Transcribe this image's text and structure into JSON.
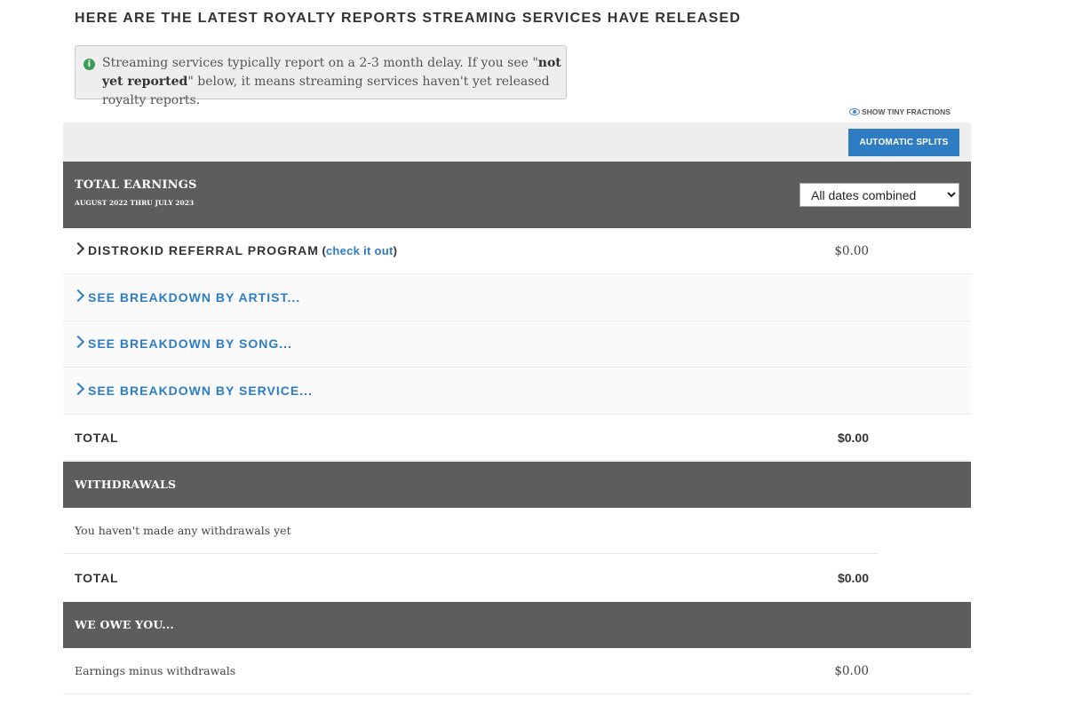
{
  "headline": "HERE ARE THE LATEST ROYALTY REPORTS STREAMING SERVICES HAVE RELEASED",
  "notice": {
    "icon": "info-icon",
    "text_before": "Streaming services typically report on a 2-3 month delay. If you see \"",
    "text_bold": "not yet reported",
    "text_after": "\" below, it means streaming services haven't yet released royalty reports."
  },
  "toolbar": {
    "fractions_label": "SHOW TINY FRACTIONS",
    "splits_label": "AUTOMATIC SPLITS"
  },
  "total_earnings": {
    "title": "TOTAL EARNINGS",
    "range": "AUGUST 2022 THRU JULY 2023",
    "date_filter": "All dates combined"
  },
  "rows": {
    "referral": {
      "label": "DISTROKID REFERRAL PROGRAM",
      "paren_open": " (",
      "link": "check it out",
      "paren_close": ")",
      "amount": "$0.00"
    },
    "by_artist": "SEE BREAKDOWN BY ARTIST...",
    "by_song": "SEE BREAKDOWN BY SONG...",
    "by_service": "SEE BREAKDOWN BY SERVICE...",
    "earnings_total": {
      "label": "TOTAL",
      "amount": "$0.00"
    }
  },
  "withdrawals": {
    "title": "WITHDRAWALS",
    "empty_message": "You haven't made any withdrawals yet",
    "total_label": "TOTAL",
    "total_amount": "$0.00"
  },
  "we_owe": {
    "title": "WE OWE YOU...",
    "row_label": "Earnings minus withdrawals",
    "row_amount": "$0.00"
  },
  "colors": {
    "accent": "#2e7cc2",
    "section_header": "#5d5d5d",
    "info_green": "#3a9a56"
  }
}
